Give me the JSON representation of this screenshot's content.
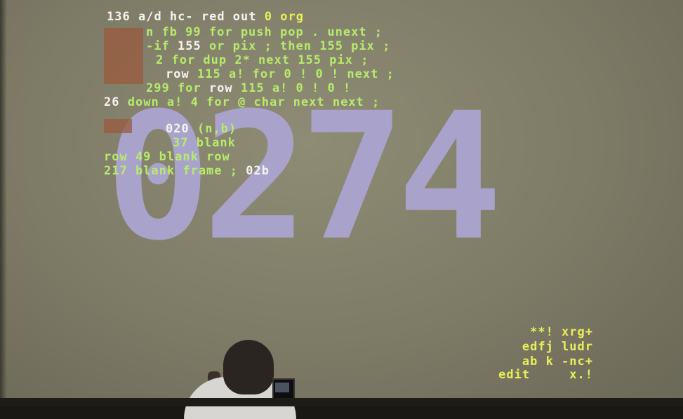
{
  "display": {
    "big_number": "0274"
  },
  "code": {
    "line1": {
      "a": "136",
      "b": "a/d hc- red out",
      "c": "0 org"
    },
    "line2": {
      "b": "n fb 99 for push pop . unext ;"
    },
    "line3": {
      "b": "-if",
      "c": "155",
      "d": "or pix ; then 155 pix ;"
    },
    "line4": {
      "b": "2 for dup 2* next 155 pix ;"
    },
    "line5": {
      "b": "row",
      "c": "115 a! for 0 ! 0 ! next ;"
    },
    "line6": {
      "b": "299 for",
      "c": "row",
      "d": "115 a! 0 ! 0 !"
    },
    "line7": {
      "a": "26",
      "b": "down a! 4 for @ char next next ;"
    },
    "line8": {
      "b": "020",
      "c": "(n,b)"
    },
    "line9": {
      "b": "37 blank"
    },
    "line10": {
      "b": "row 49 blank row"
    },
    "line11": {
      "b": "217 blank frame ;",
      "c": "02b"
    }
  },
  "keys": {
    "row1": "**! xrg+",
    "row2": "edfj ludr",
    "row3": "ab k -nc+",
    "row4": "edit     x.!"
  },
  "colors": {
    "screen_bg": "#7d7b66",
    "big_number": "#a9a3cc",
    "white_text": "#f4f4f0",
    "green_text": "#b8ea6c",
    "yellow_text": "#e8f05a"
  }
}
